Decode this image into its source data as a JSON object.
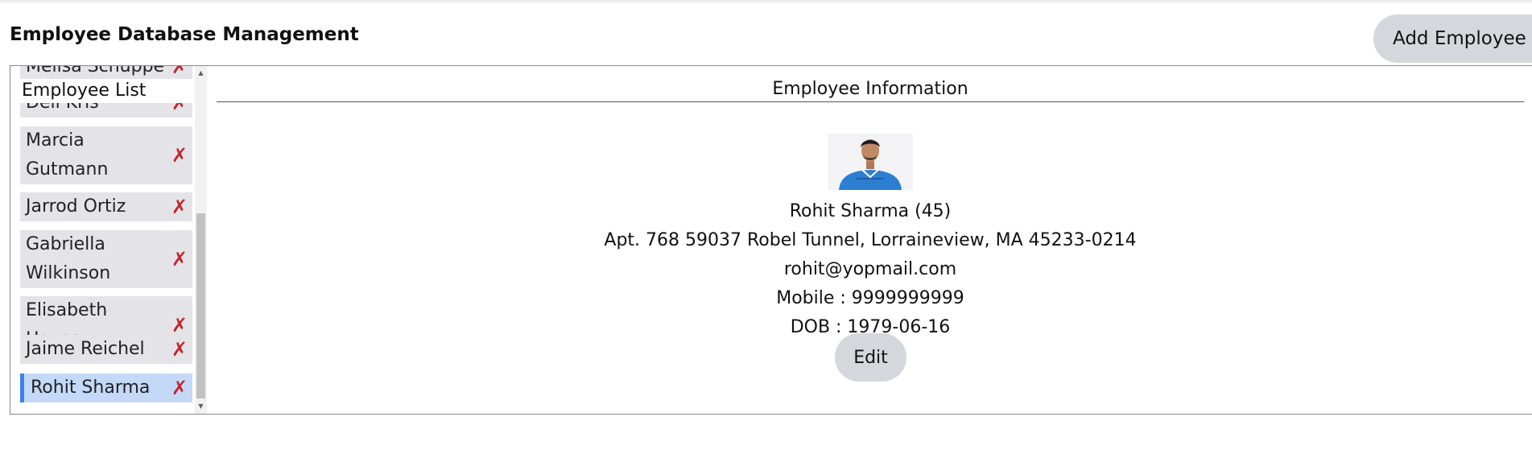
{
  "header": {
    "title": "Employee Database Management",
    "add_button_label": "Add Employee"
  },
  "employee_list": {
    "heading": "Employee List",
    "delete_glyph": "✗",
    "items": [
      {
        "name": "Melisa Schuppe"
      },
      {
        "name": "Dell Kris"
      },
      {
        "name": "Marcia Gutmann"
      },
      {
        "name": "Jarrod Ortiz"
      },
      {
        "name": "Gabriella Wilkinson"
      },
      {
        "name": "Elisabeth Hayes"
      },
      {
        "name": "Jaime Reichel"
      },
      {
        "name": "Rohit Sharma",
        "selected": true
      }
    ]
  },
  "employee_info": {
    "heading": "Employee Information",
    "name_age": "Rohit Sharma (45)",
    "address": "Apt. 768 59037 Robel Tunnel, Lorraineview, MA 45233-0214",
    "email": "rohit@yopmail.com",
    "mobile": "Mobile : 9999999999",
    "dob": "DOB : 1979-06-16",
    "edit_label": "Edit"
  },
  "colors": {
    "accent": "#3a84e6",
    "delete": "#c1272d",
    "button_bg": "#d5d7dc",
    "list_item_bg": "#e4e4e8",
    "selected_bg": "#c3d9f7"
  },
  "icons": {
    "delete": "close-icon",
    "avatar": "employee-photo"
  }
}
